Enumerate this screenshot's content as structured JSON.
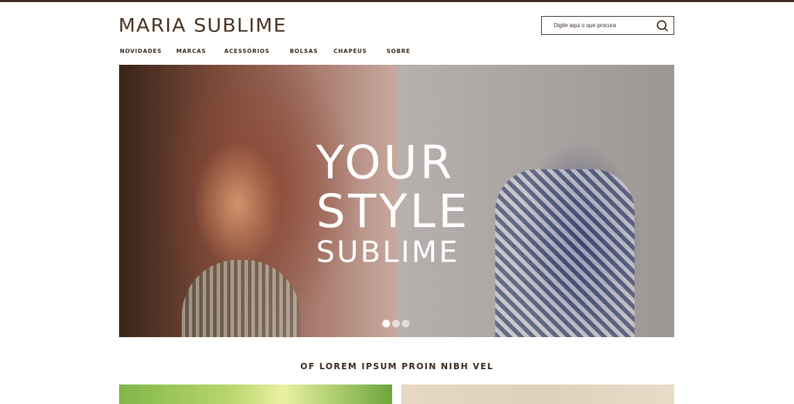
{
  "brand": {
    "logo_text": "MARIA SUBLIME"
  },
  "search": {
    "placeholder": "Digite aqui o que procura",
    "icon": "search-icon"
  },
  "nav": {
    "items": [
      {
        "label": "NOVIDADES"
      },
      {
        "label": "MARCAS"
      },
      {
        "label": "ACESSÓRIOS"
      },
      {
        "label": "BOLSAS"
      },
      {
        "label": "CHAPÉUS"
      },
      {
        "label": "SOBRE"
      }
    ]
  },
  "hero": {
    "line1": "YOUR",
    "line2": "STYLE",
    "line3": "SUBLIME",
    "slides_total": 3,
    "active_slide": 1
  },
  "section": {
    "title": "OF LOREM IPSUM PROIN NIBH VEL"
  },
  "colors": {
    "brand_brown": "#3b2a20",
    "background": "#ffffff",
    "hero_text": "#ffffff"
  }
}
